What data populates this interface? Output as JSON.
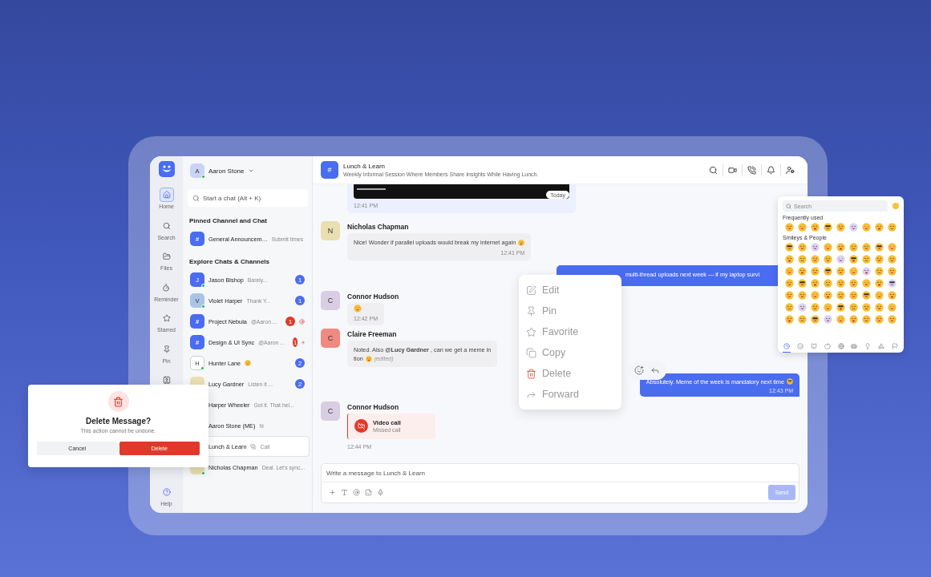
{
  "rail": {
    "items": [
      {
        "label": "Home",
        "selected": true
      },
      {
        "label": "Search",
        "selected": false
      },
      {
        "label": "Files",
        "selected": false
      },
      {
        "label": "Reminder",
        "selected": false
      },
      {
        "label": "Starred",
        "selected": false
      },
      {
        "label": "Pin",
        "selected": false
      },
      {
        "selected": false
      }
    ],
    "help": "Help"
  },
  "sidebar": {
    "user": {
      "initial": "A",
      "name": "Aaron Stone",
      "online": true
    },
    "search": {
      "placeholder": "Start a chat (Alt + K)"
    },
    "sections": [
      {
        "title": "Pinned Channel and Chat",
        "chats": [
          {
            "kind": "channel",
            "initial": "#",
            "color": "#4a6cf0",
            "name": "General Announcem…",
            "preview": {
              "kind": "text",
              "text": "Submit times"
            },
            "online": false,
            "selected": false
          }
        ]
      },
      {
        "title": "Explore Chats & Channels",
        "chats": [
          {
            "kind": "person",
            "initial": "J",
            "color": "#4a6cf0",
            "name": "Jason Bishop",
            "preview": {
              "kind": "text",
              "text": "Barely..."
            },
            "online": true,
            "selected": false,
            "badge": {
              "count": "1",
              "mention": false
            }
          },
          {
            "kind": "person",
            "initial": "V",
            "color": "#a9c4e6",
            "name": "Violet Harper",
            "preview": {
              "kind": "text",
              "text": "Thank Y..."
            },
            "online": true,
            "selected": false,
            "badge": {
              "count": "1",
              "mention": false
            }
          },
          {
            "kind": "channel",
            "initial": "#",
            "color": "#4a6cf0",
            "name": "Project Nebula",
            "preview": {
              "kind": "text",
              "text": "@Aaron ..."
            },
            "online": false,
            "selected": false,
            "badge": {
              "count": "1",
              "mention": true
            }
          },
          {
            "kind": "channel",
            "initial": "#",
            "color": "#4a6cf0",
            "name": "Design & UI Sync",
            "preview": {
              "kind": "text",
              "text": "@Aaron ..."
            },
            "online": false,
            "selected": false,
            "badge": {
              "count": "1",
              "mention": true
            }
          },
          {
            "kind": "person",
            "initial": "H",
            "color": "#ffffff",
            "name": "Hunter Lane",
            "preview": {
              "kind": "emoji"
            },
            "online": true,
            "selected": false,
            "badge": {
              "count": "2",
              "mention": false
            }
          },
          {
            "kind": "person",
            "color": "#e9dfb0",
            "name": "Lucy Gardner",
            "preview": {
              "kind": "text",
              "text": "Listen it ..."
            },
            "online": false,
            "selected": false,
            "badge": {
              "count": "2",
              "mention": false
            }
          },
          {
            "kind": "hidden",
            "name": "Harper Wheeler",
            "preview": {
              "kind": "text",
              "text": "Got it. That hel..."
            },
            "selected": false
          },
          {
            "kind": "hidden",
            "name": "Aaron Stone (ME)",
            "preview": {
              "kind": "text",
              "text": "hi"
            },
            "selected": false
          },
          {
            "kind": "hidden",
            "name": "Lunch & Learn",
            "preview": {
              "kind": "call",
              "text": "Call"
            },
            "selected": true
          },
          {
            "kind": "person",
            "color": "#e9dfb0",
            "name": "Nicholas Chapman",
            "preview": {
              "kind": "text",
              "text": "Deal. Let's sync..."
            },
            "online": true,
            "selected": false
          }
        ]
      }
    ]
  },
  "channel": {
    "initial": "#",
    "name": "Lunch & Learn",
    "description": "Weekly Informal Session Where Members Share Insights While Having Lunch."
  },
  "messages": [
    {
      "kind": "media",
      "tag": "Today",
      "time": "12:41 PM"
    },
    {
      "kind": "incoming",
      "author": "Nicholas Chapman",
      "initial": "N",
      "color": "#e9dfb0",
      "lines": [
        "Nice! Wonder if parallel uploads would break my internet again"
      ],
      "emoji": true,
      "time": "12:41 PM"
    },
    {
      "kind": "outgoing",
      "lines": [
        "multi-thread uploads next week — if my laptop survi"
      ]
    },
    {
      "kind": "incoming",
      "author": "Connor Hudson",
      "initial": "C",
      "color": "#d9cde3",
      "emoji": true,
      "time": "12:42 PM"
    },
    {
      "kind": "incoming",
      "author": "Claire Freeman",
      "initial": "C",
      "color": "#ee8a80",
      "lines": [
        "Noted. Also **@Lucy Gardner** , can we get a meme in",
        "tion"
      ],
      "emoji": true,
      "edited": "(edited)"
    },
    {
      "kind": "outgoing",
      "lines": [
        "Absolutely. Meme of the week is mandatory next time"
      ],
      "emoji": true,
      "time": "12:43 PM"
    },
    {
      "kind": "call",
      "author": "Connor Hudson",
      "initial": "C",
      "color": "#d9cde3",
      "title": "Video call",
      "subtitle": "Missed call",
      "time": "12:44 PM"
    }
  ],
  "composer": {
    "placeholder": "Write a message to Lunch & Learn",
    "send": {
      "label": "Send",
      "disabled": true
    }
  },
  "context_menu": {
    "items": [
      {
        "label": "Edit",
        "kind": "normal"
      },
      {
        "label": "Pin",
        "kind": "normal"
      },
      {
        "label": "Favorite",
        "kind": "normal"
      },
      {
        "label": "Copy",
        "kind": "normal"
      },
      {
        "label": "Delete",
        "kind": "danger"
      },
      {
        "label": "Forward",
        "kind": "normal"
      }
    ]
  },
  "emoji_picker": {
    "search": {
      "placeholder": "Search"
    },
    "sections": [
      {
        "title": "Frequently used"
      },
      {
        "title": "Smileys & People"
      }
    ],
    "categories": [
      {
        "selected": true
      },
      {
        "selected": false
      },
      {
        "selected": false
      },
      {
        "selected": false
      },
      {
        "selected": false
      },
      {
        "selected": false
      },
      {
        "selected": false
      },
      {
        "selected": false
      },
      {
        "selected": false
      }
    ]
  },
  "dialog": {
    "title": "Delete Message?",
    "message": "This action cannot be undone.",
    "buttons": [
      {
        "label": "Cancel",
        "kind": "secondary"
      },
      {
        "label": "Delete",
        "kind": "danger"
      }
    ]
  }
}
